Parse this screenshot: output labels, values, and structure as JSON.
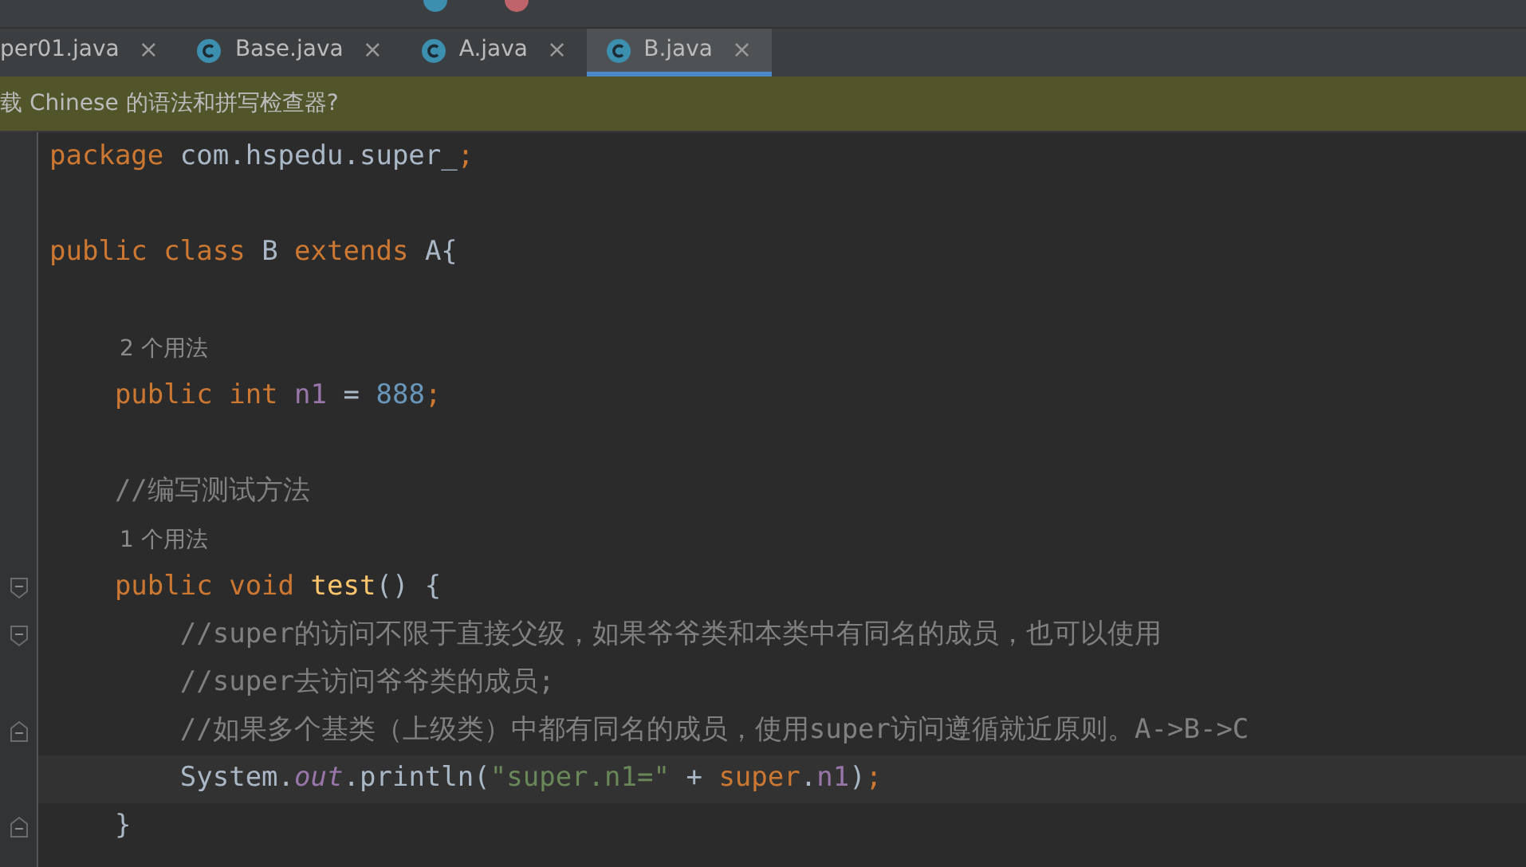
{
  "tabs": [
    {
      "label": "per01.java",
      "icon": false,
      "close": "×",
      "selected": false
    },
    {
      "label": "Base.java",
      "icon": true,
      "close": "×",
      "selected": false
    },
    {
      "label": "A.java",
      "icon": true,
      "close": "×",
      "selected": false
    },
    {
      "label": "B.java",
      "icon": true,
      "close": "×",
      "selected": true
    }
  ],
  "banner": {
    "text": "载 Chinese 的语法和拼写检查器?"
  },
  "lines": [
    {
      "kind": "code",
      "current": false,
      "tokens": [
        {
          "kind": "keyword",
          "text": "package "
        },
        {
          "kind": "plain",
          "text": "com.hspedu.super_"
        },
        {
          "kind": "keyword",
          "text": ";"
        }
      ]
    },
    {
      "kind": "blank"
    },
    {
      "kind": "code",
      "current": false,
      "tokens": [
        {
          "kind": "keyword",
          "text": "public class "
        },
        {
          "kind": "plain",
          "text": "B "
        },
        {
          "kind": "keyword",
          "text": "extends "
        },
        {
          "kind": "plain",
          "text": "A{"
        }
      ]
    },
    {
      "kind": "blank"
    },
    {
      "kind": "hint",
      "text": "2 个用法"
    },
    {
      "kind": "code",
      "current": false,
      "tokens": [
        {
          "kind": "keyword",
          "text": "    public int "
        },
        {
          "kind": "field",
          "text": "n1"
        },
        {
          "kind": "plain",
          "text": " = "
        },
        {
          "kind": "number",
          "text": "888"
        },
        {
          "kind": "keyword",
          "text": ";"
        }
      ]
    },
    {
      "kind": "blank"
    },
    {
      "kind": "code",
      "current": false,
      "tokens": [
        {
          "kind": "comment",
          "text": "    //编写测试方法"
        }
      ]
    },
    {
      "kind": "hint",
      "text": "1 个用法"
    },
    {
      "kind": "code",
      "current": false,
      "fold_start": true,
      "tokens": [
        {
          "kind": "keyword",
          "text": "    public void "
        },
        {
          "kind": "method",
          "text": "test"
        },
        {
          "kind": "plain",
          "text": "() {"
        }
      ]
    },
    {
      "kind": "code",
      "current": false,
      "fold_start": true,
      "tokens": [
        {
          "kind": "comment",
          "text": "        //super的访问不限于直接父级，如果爷爷类和本类中有同名的成员，也可以使用"
        }
      ]
    },
    {
      "kind": "code",
      "current": false,
      "tokens": [
        {
          "kind": "comment",
          "text": "        //super去访问爷爷类的成员;"
        }
      ]
    },
    {
      "kind": "code",
      "current": false,
      "fold_end": true,
      "tokens": [
        {
          "kind": "comment",
          "text": "        //如果多个基类（上级类）中都有同名的成员，使用super访问遵循就近原则。A->B->C"
        }
      ]
    },
    {
      "kind": "code",
      "current": true,
      "tokens": [
        {
          "kind": "plain",
          "text": "        System."
        },
        {
          "kind": "static",
          "text": "out"
        },
        {
          "kind": "plain",
          "text": ".println("
        },
        {
          "kind": "string",
          "text": "\"super.n1=\""
        },
        {
          "kind": "plain",
          "text": " + "
        },
        {
          "kind": "keyword",
          "text": "super"
        },
        {
          "kind": "plain",
          "text": "."
        },
        {
          "kind": "field",
          "text": "n1"
        },
        {
          "kind": "plain",
          "text": ")"
        },
        {
          "kind": "keyword",
          "text": ";"
        }
      ]
    },
    {
      "kind": "code",
      "current": false,
      "fold_end": true,
      "tokens": [
        {
          "kind": "plain",
          "text": "    }"
        }
      ]
    }
  ]
}
